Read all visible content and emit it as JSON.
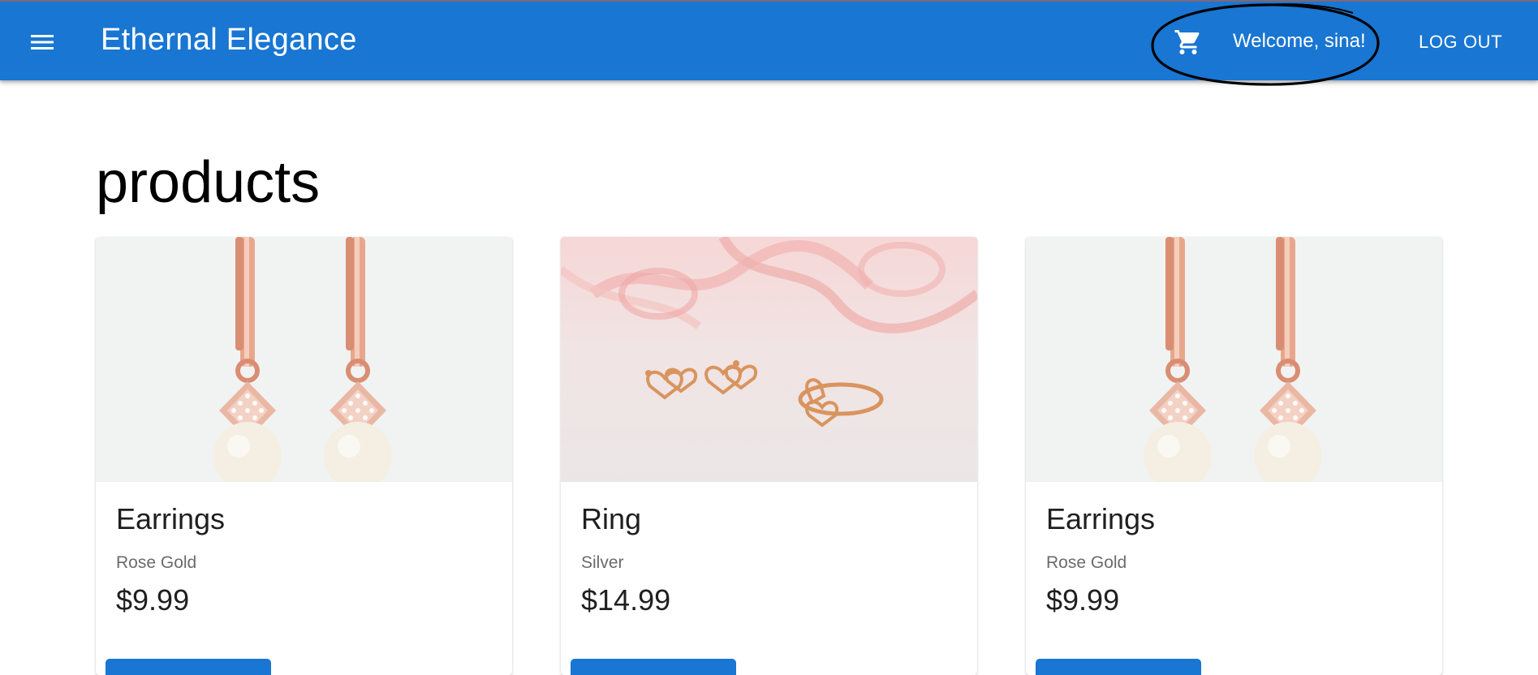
{
  "appbar": {
    "title": "Ethernal Elegance",
    "welcome_text": "Welcome, sina!",
    "logout_label": "LOG OUT",
    "menu_icon": "menu-icon",
    "cart_icon": "shopping-cart-icon",
    "background_color": "#1976d2"
  },
  "main": {
    "heading": "products",
    "products": [
      {
        "name": "Earrings",
        "material": "Rose Gold",
        "price": "$9.99",
        "image": "rose-gold-pearl-drop-earrings"
      },
      {
        "name": "Ring",
        "material": "Silver",
        "price": "$14.99",
        "image": "heart-earrings-and-ring-set"
      },
      {
        "name": "Earrings",
        "material": "Rose Gold",
        "price": "$9.99",
        "image": "rose-gold-pearl-drop-earrings"
      }
    ]
  },
  "colors": {
    "primary": "#1976d2",
    "annotation": "#000000"
  }
}
